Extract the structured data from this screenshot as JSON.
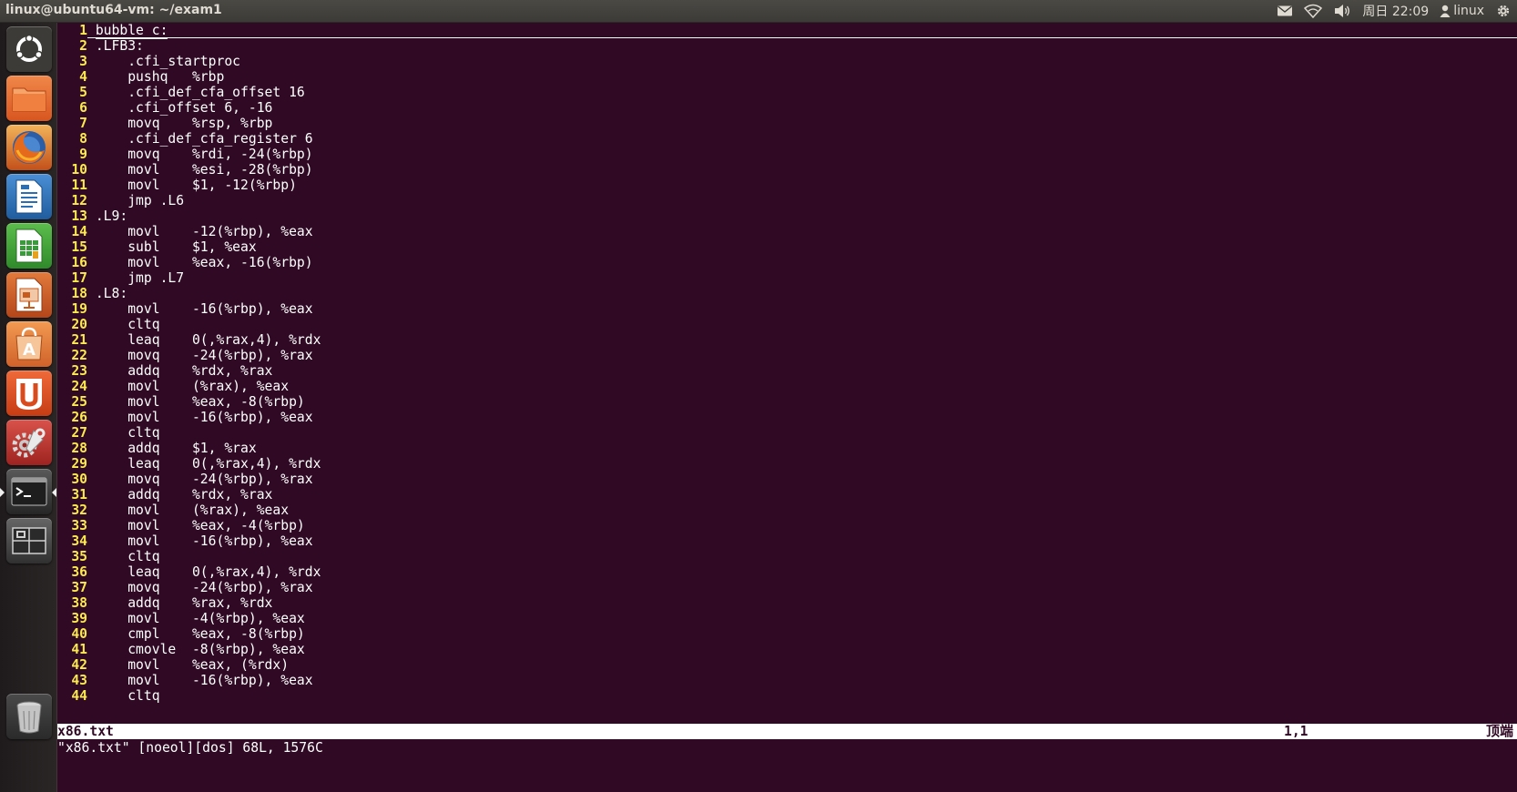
{
  "panel": {
    "window_title": "linux@ubuntu64-vm: ~/exam1",
    "clock": "周日 22:09",
    "user": "linux"
  },
  "launcher": {
    "items": [
      {
        "name": "dash-home",
        "icon": "ubuntu-logo-icon",
        "color": "#3c3b37"
      },
      {
        "name": "files",
        "icon": "folder-icon",
        "color": "#e0662a"
      },
      {
        "name": "firefox",
        "icon": "firefox-icon",
        "color": "#d9541b"
      },
      {
        "name": "libreoffice-writer",
        "icon": "writer-icon",
        "color": "#2a6fb4"
      },
      {
        "name": "libreoffice-calc",
        "icon": "calc-icon",
        "color": "#3b9a3b"
      },
      {
        "name": "libreoffice-impress",
        "icon": "impress-icon",
        "color": "#c85a1e"
      },
      {
        "name": "software-center",
        "icon": "software-center-icon",
        "color": "#d9702a"
      },
      {
        "name": "ubuntu-one",
        "icon": "ubuntu-one-icon",
        "color": "#d94a1c"
      },
      {
        "name": "system-settings",
        "icon": "settings-icon",
        "color": "#b8322a"
      },
      {
        "name": "terminal",
        "icon": "terminal-icon",
        "color": "#2b2b2b"
      },
      {
        "name": "workspace-switcher",
        "icon": "workspace-icon",
        "color": "#3a3a3a"
      },
      {
        "name": "trash",
        "icon": "trash-icon",
        "color": "#4a4a4a"
      }
    ]
  },
  "terminal": {
    "lines": [
      {
        "n": "1",
        "t": "bubble_c:"
      },
      {
        "n": "2",
        "t": ".LFB3:"
      },
      {
        "n": "3",
        "t": "    .cfi_startproc"
      },
      {
        "n": "4",
        "t": "    pushq   %rbp"
      },
      {
        "n": "5",
        "t": "    .cfi_def_cfa_offset 16"
      },
      {
        "n": "6",
        "t": "    .cfi_offset 6, -16"
      },
      {
        "n": "7",
        "t": "    movq    %rsp, %rbp"
      },
      {
        "n": "8",
        "t": "    .cfi_def_cfa_register 6"
      },
      {
        "n": "9",
        "t": "    movq    %rdi, -24(%rbp)"
      },
      {
        "n": "10",
        "t": "    movl    %esi, -28(%rbp)"
      },
      {
        "n": "11",
        "t": "    movl    $1, -12(%rbp)"
      },
      {
        "n": "12",
        "t": "    jmp .L6"
      },
      {
        "n": "13",
        "t": ".L9:"
      },
      {
        "n": "14",
        "t": "    movl    -12(%rbp), %eax"
      },
      {
        "n": "15",
        "t": "    subl    $1, %eax"
      },
      {
        "n": "16",
        "t": "    movl    %eax, -16(%rbp)"
      },
      {
        "n": "17",
        "t": "    jmp .L7"
      },
      {
        "n": "18",
        "t": ".L8:"
      },
      {
        "n": "19",
        "t": "    movl    -16(%rbp), %eax"
      },
      {
        "n": "20",
        "t": "    cltq"
      },
      {
        "n": "21",
        "t": "    leaq    0(,%rax,4), %rdx"
      },
      {
        "n": "22",
        "t": "    movq    -24(%rbp), %rax"
      },
      {
        "n": "23",
        "t": "    addq    %rdx, %rax"
      },
      {
        "n": "24",
        "t": "    movl    (%rax), %eax"
      },
      {
        "n": "25",
        "t": "    movl    %eax, -8(%rbp)"
      },
      {
        "n": "26",
        "t": "    movl    -16(%rbp), %eax"
      },
      {
        "n": "27",
        "t": "    cltq"
      },
      {
        "n": "28",
        "t": "    addq    $1, %rax"
      },
      {
        "n": "29",
        "t": "    leaq    0(,%rax,4), %rdx"
      },
      {
        "n": "30",
        "t": "    movq    -24(%rbp), %rax"
      },
      {
        "n": "31",
        "t": "    addq    %rdx, %rax"
      },
      {
        "n": "32",
        "t": "    movl    (%rax), %eax"
      },
      {
        "n": "33",
        "t": "    movl    %eax, -4(%rbp)"
      },
      {
        "n": "34",
        "t": "    movl    -16(%rbp), %eax"
      },
      {
        "n": "35",
        "t": "    cltq"
      },
      {
        "n": "36",
        "t": "    leaq    0(,%rax,4), %rdx"
      },
      {
        "n": "37",
        "t": "    movq    -24(%rbp), %rax"
      },
      {
        "n": "38",
        "t": "    addq    %rax, %rdx"
      },
      {
        "n": "39",
        "t": "    movl    -4(%rbp), %eax"
      },
      {
        "n": "40",
        "t": "    cmpl    %eax, -8(%rbp)"
      },
      {
        "n": "41",
        "t": "    cmovle  -8(%rbp), %eax"
      },
      {
        "n": "42",
        "t": "    movl    %eax, (%rdx)"
      },
      {
        "n": "43",
        "t": "    movl    -16(%rbp), %eax"
      },
      {
        "n": "44",
        "t": "    cltq"
      }
    ],
    "status": {
      "filename": "x86.txt",
      "position": "1,1",
      "scroll": "顶端"
    },
    "message": "\"x86.txt\" [noeol][dos] 68L, 1576C"
  },
  "colors": {
    "terminal_bg": "#300a24",
    "line_number": "#fce94f",
    "text": "#ffffff",
    "panel_bg": "#3c3b37"
  }
}
